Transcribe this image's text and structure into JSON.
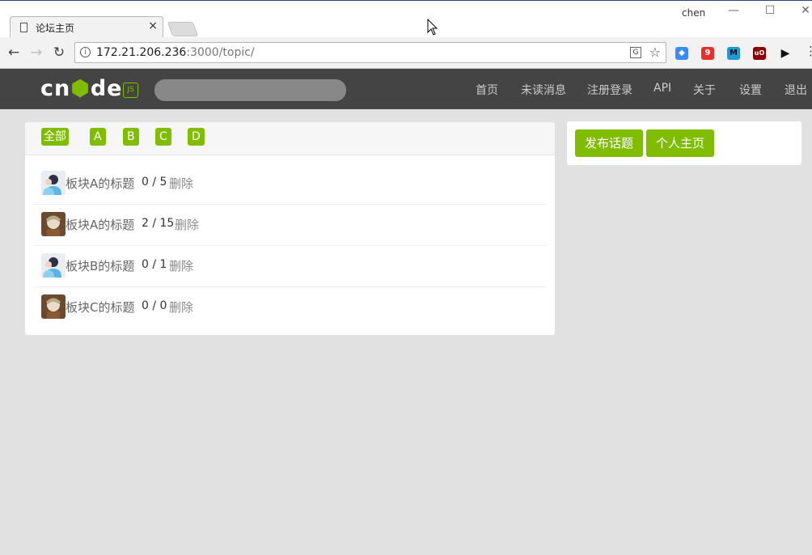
{
  "browser": {
    "tab_title": "论坛主页",
    "tab_close": "×",
    "user": "chen",
    "url_host": "172.21.206.236",
    "url_path": ":3000/topic/",
    "back_glyph": "←",
    "forward_glyph": "→",
    "reload_glyph": "↻",
    "info_glyph": "i",
    "translate_glyph": "G",
    "star_glyph": "☆",
    "menu_glyph": "⋮",
    "minimize_glyph": "—",
    "maximize_glyph": "☐",
    "close_glyph": "✕",
    "extensions": [
      {
        "name": "blue-extension-icon",
        "color": "#3b8cf0",
        "glyph": "◆"
      },
      {
        "name": "red-extension-icon",
        "color": "#e2322b",
        "glyph": "9"
      },
      {
        "name": "m-extension-icon",
        "color": "#1b9ad6",
        "glyph": "M"
      },
      {
        "name": "ublock-icon",
        "color": "#8b0000",
        "glyph": "uO"
      },
      {
        "name": "play-extension-icon",
        "color": "#ffffff",
        "glyph": "▶"
      }
    ]
  },
  "site": {
    "logo_text_a": "cn",
    "logo_hex": "⬢",
    "logo_text_b": "de",
    "logo_badge": "JS",
    "search_placeholder": "",
    "nav": [
      "首页",
      "未读消息",
      "注册登录",
      "API",
      "关于",
      "设置",
      "退出"
    ],
    "accent": "#80bd01"
  },
  "board_tabs": [
    "全部",
    "A",
    "B",
    "C",
    "D"
  ],
  "topics": [
    {
      "title": "板块A的标题",
      "count": "0 / 5",
      "action": "删除",
      "avatar": "default"
    },
    {
      "title": "板块A的标题",
      "count": "2 / 15",
      "action": "删除",
      "avatar": "anime"
    },
    {
      "title": "板块B的标题",
      "count": "0 / 1",
      "action": "删除",
      "avatar": "default"
    },
    {
      "title": "板块C的标题",
      "count": "0 / 0",
      "action": "删除",
      "avatar": "anime"
    }
  ],
  "sidebar": {
    "publish_label": "发布话题",
    "profile_label": "个人主页"
  }
}
